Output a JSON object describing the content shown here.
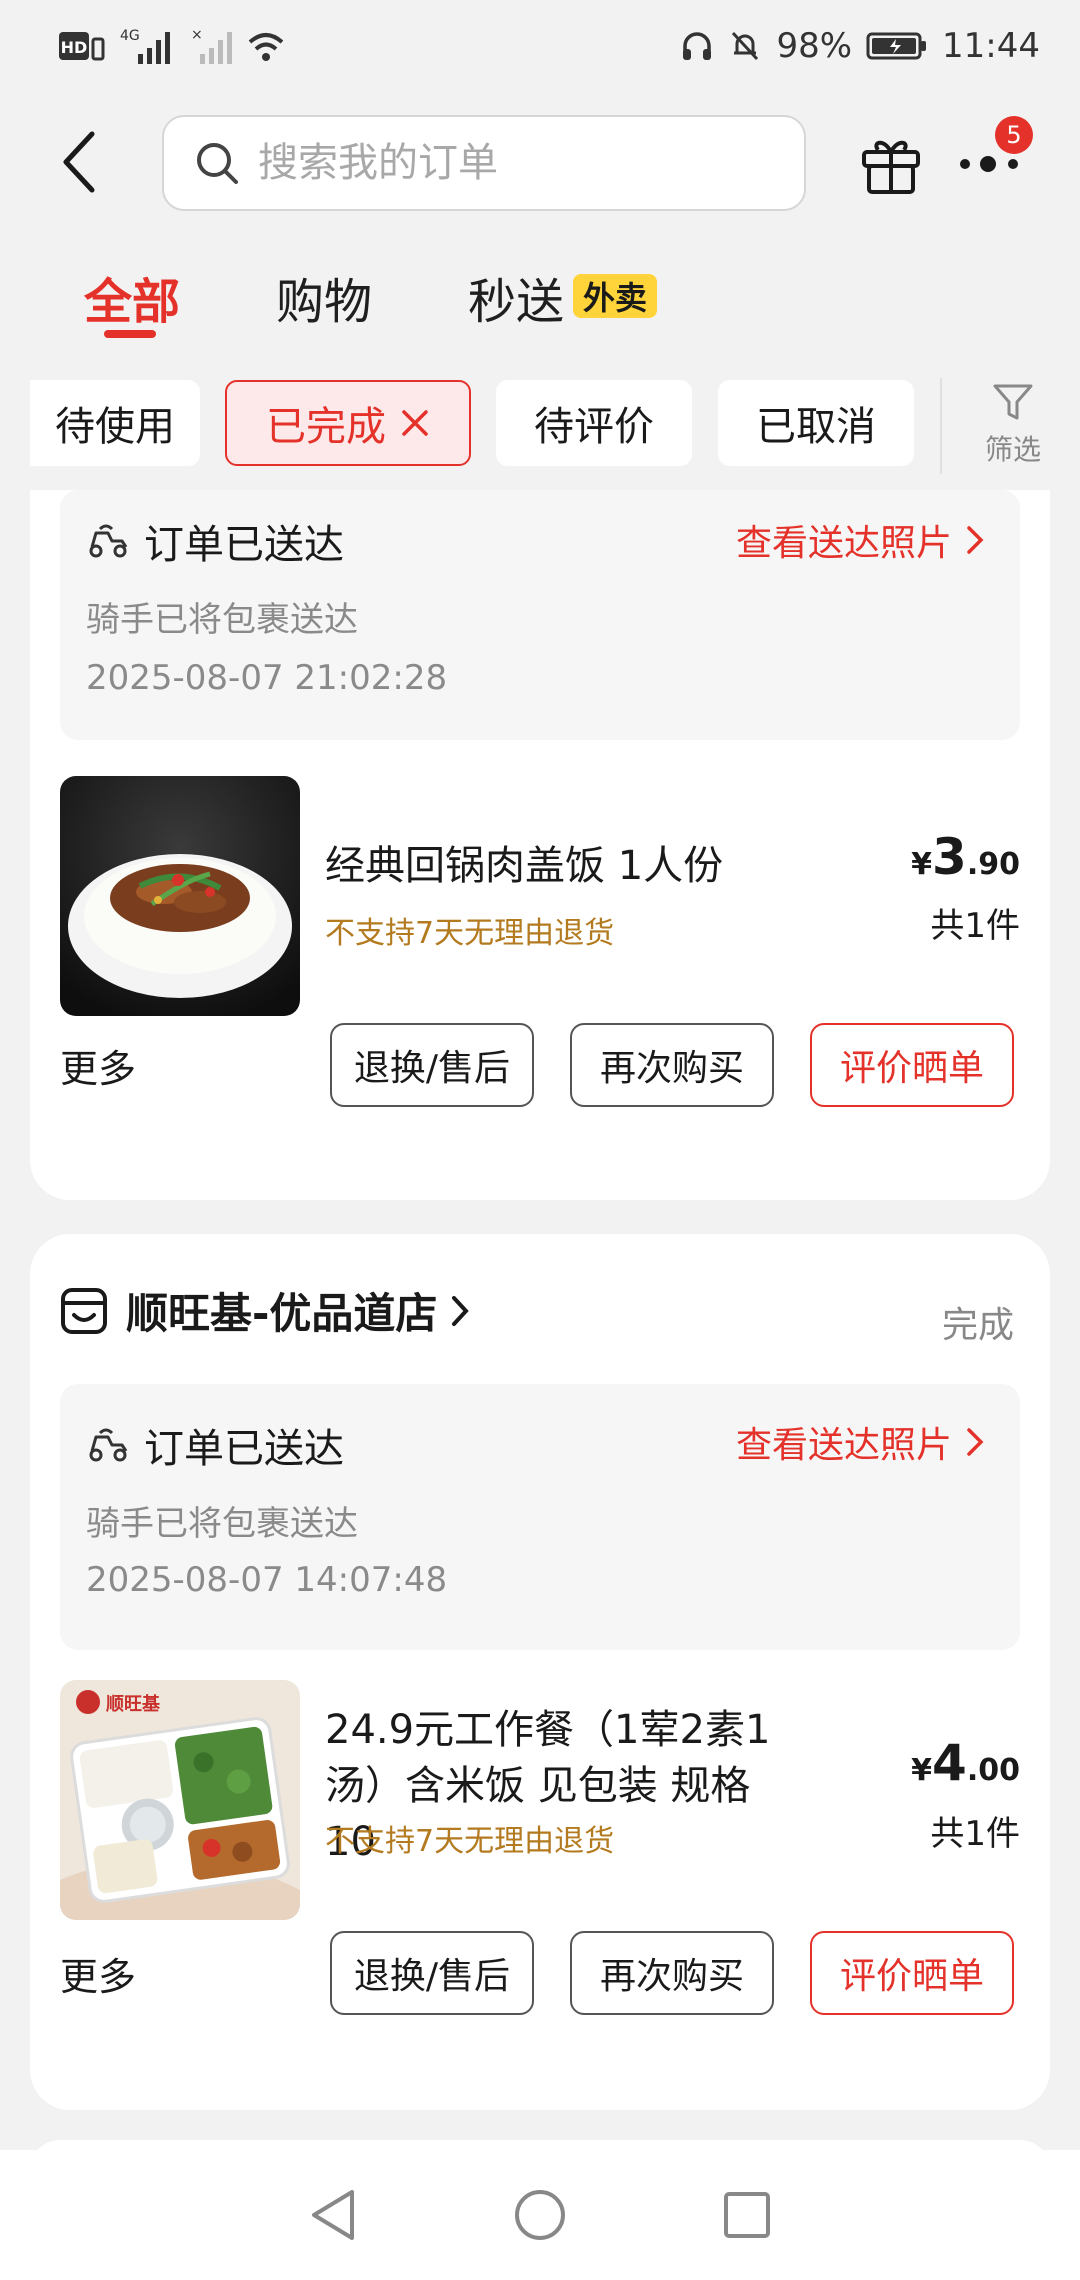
{
  "status_bar": {
    "left_labels": [
      "HD",
      "4G"
    ],
    "battery": "98%",
    "time": "11:44"
  },
  "header": {
    "search_placeholder": "搜索我的订单",
    "badge_count": "5"
  },
  "tabs": [
    {
      "label": "全部",
      "active": true
    },
    {
      "label": "购物",
      "active": false
    },
    {
      "label": "秒送",
      "active": false,
      "tag": "外卖"
    }
  ],
  "chips": [
    {
      "label": "待使用",
      "active": false
    },
    {
      "label": "已完成",
      "active": true
    },
    {
      "label": "待评价",
      "active": false
    },
    {
      "label": "已取消",
      "active": false
    }
  ],
  "filter_label": "筛选",
  "orders": [
    {
      "delivery": {
        "title": "订单已送达",
        "link": "查看送达照片",
        "sub": "骑手已将包裹送达",
        "time": "2025-08-07 21:02:28"
      },
      "product": {
        "name": "经典回锅肉盖饭 1人份",
        "note": "不支持7天无理由退货",
        "price_currency": "¥",
        "price_int": "3",
        "price_dec": ".90",
        "qty": "共1件"
      },
      "more": "更多",
      "buttons": [
        "退换/售后",
        "再次购买",
        "评价晒单"
      ]
    },
    {
      "store": "顺旺基-优品道店",
      "status": "完成",
      "delivery": {
        "title": "订单已送达",
        "link": "查看送达照片",
        "sub": "骑手已将包裹送达",
        "time": "2025-08-07 14:07:48"
      },
      "product": {
        "name": "24.9元工作餐（1荤2素1汤）含米饭 见包装 规格10",
        "note": "不支持7天无理由退货",
        "price_currency": "¥",
        "price_int": "4",
        "price_dec": ".00",
        "qty": "共1件",
        "thumb_brand": "顺旺基"
      },
      "more": "更多",
      "buttons": [
        "退换/售后",
        "再次购买",
        "评价晒单"
      ]
    }
  ],
  "colors": {
    "accent": "#e4322b",
    "note": "#b37a1f",
    "tag_yellow": "#ffd43a"
  }
}
